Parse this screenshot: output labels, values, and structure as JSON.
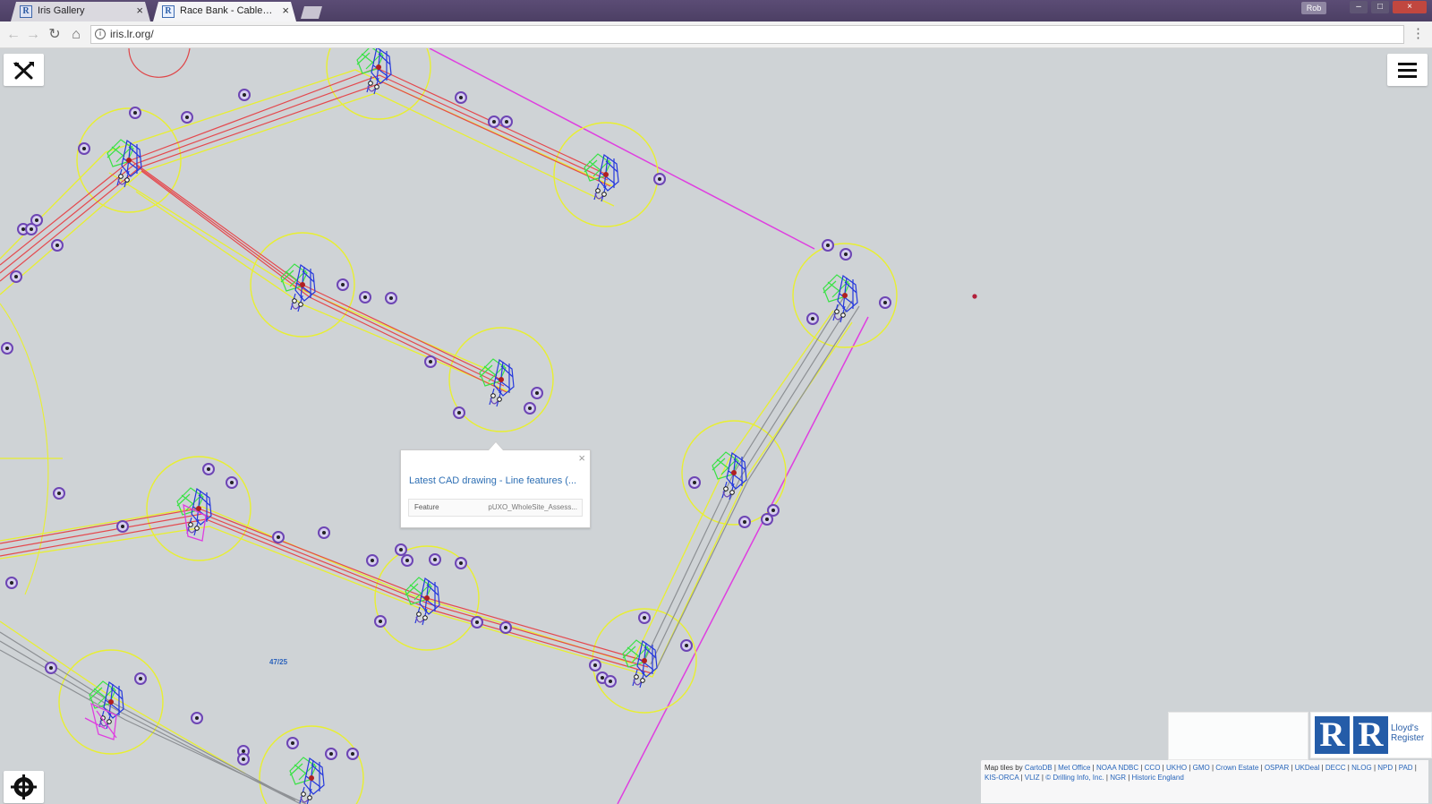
{
  "browser": {
    "tabs": [
      {
        "label": "Iris Gallery",
        "favicon": "lr-favicon-icon",
        "close": "×"
      },
      {
        "label": "Race Bank - Cable Install",
        "favicon": "lr-favicon-icon",
        "close": "×"
      }
    ],
    "profile": "Rob",
    "address": "iris.lr.org/",
    "nav_icons": {
      "back": "←",
      "forward": "→",
      "reload": "↻",
      "home": "⌂",
      "info": "i",
      "menu": "⋮"
    },
    "window_controls": {
      "minimize": "–",
      "restore": "□",
      "close": "×"
    }
  },
  "map": {
    "popup": {
      "close": "×",
      "title": "Latest CAD drawing - Line features (...",
      "field_key": "Feature",
      "field_value": "pUXO_WholeSite_Assess..."
    },
    "label": "47/25",
    "logo": {
      "mark_1": "R",
      "mark_2": "R",
      "name": "Lloyd's Register"
    },
    "attribution": {
      "prefix": "Map tiles by",
      "items": [
        "CartoDB",
        "Met Office",
        "NOAA NDBC",
        "CCO",
        "UKHO",
        "GMO",
        "Crown Estate",
        "OSPAR",
        "UKDeal",
        "DECC",
        "NLOG",
        "NPD",
        "PAD",
        "KIS-ORCA",
        "VLIZ",
        "© Drilling Info, Inc.",
        "NGR",
        "Historic England"
      ]
    },
    "colors": {
      "background": "#cfd3d6",
      "yellow": "#e8ef31",
      "red": "#e4494e",
      "magenta": "#df3ee0",
      "green": "#39e245",
      "blue": "#2538dd",
      "purple": "#6d45b4"
    }
  }
}
